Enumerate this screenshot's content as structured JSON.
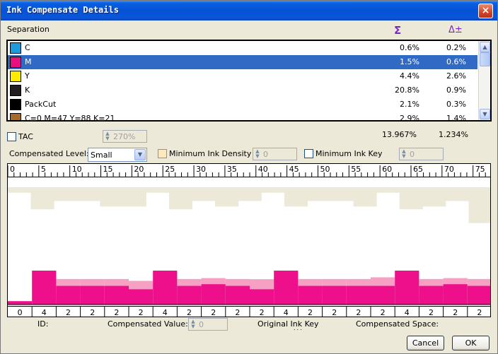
{
  "window": {
    "title": "Ink Compensate Details",
    "close_label": "×"
  },
  "separation": {
    "label": "Separation",
    "sum_icon": "Σ",
    "delta_icon": "Δ±",
    "rows": [
      {
        "name": "C",
        "v1": "0.6%",
        "v2": "0.2%",
        "color": "#1e9bdc",
        "selected": false
      },
      {
        "name": "M",
        "v1": "1.5%",
        "v2": "0.6%",
        "color": "#e8107e",
        "selected": true
      },
      {
        "name": "Y",
        "v1": "4.4%",
        "v2": "2.6%",
        "color": "#ffeb00",
        "selected": false
      },
      {
        "name": "K",
        "v1": "20.8%",
        "v2": "0.9%",
        "color": "#231f20",
        "selected": false
      },
      {
        "name": "PackCut",
        "v1": "2.1%",
        "v2": "0.3%",
        "color": "#000000",
        "selected": false
      },
      {
        "name": "C=0 M=47 Y=88 K=21",
        "v1": "2.9%",
        "v2": "1.4%",
        "color": "#a86a2a",
        "selected": false
      }
    ],
    "total_v1": "13.967%",
    "total_v2": "1.234%"
  },
  "tac": {
    "label": "TAC",
    "value": "270%"
  },
  "compensated_level": {
    "label": "Compensated Level:",
    "value": "Small"
  },
  "min_ink_density": {
    "label": "Minimum Ink Density",
    "value": "0"
  },
  "min_ink_key": {
    "label": "Minimum Ink Key",
    "value": "0"
  },
  "chart_data": {
    "type": "bar",
    "ruler_labels": [
      "0",
      "5",
      "10",
      "15",
      "20",
      "25",
      "30",
      "35",
      "40",
      "45",
      "50",
      "55",
      "60",
      "65",
      "70",
      "75"
    ],
    "keys": [
      "0",
      "4",
      "2",
      "2",
      "2",
      "2",
      "4",
      "2",
      "2",
      "2",
      "2",
      "4",
      "2",
      "2",
      "2",
      "2",
      "4",
      "2",
      "2",
      "2"
    ],
    "upper_profile": [
      0.1,
      0.4,
      0.25,
      0.25,
      0.35,
      0.35,
      0.1,
      0.4,
      0.25,
      0.35,
      0.25,
      0.1,
      0.35,
      0.25,
      0.25,
      0.35,
      0.1,
      0.4,
      0.35,
      0.25,
      0.65
    ],
    "lower_values": [
      0.1,
      1.0,
      0.55,
      0.55,
      0.55,
      0.45,
      1.0,
      0.55,
      0.6,
      0.55,
      0.45,
      1.0,
      0.55,
      0.55,
      0.55,
      0.55,
      1.0,
      0.55,
      0.6,
      0.55
    ],
    "lower_overlay": [
      0.0,
      0.0,
      0.45,
      0.45,
      0.45,
      0.45,
      0.0,
      0.45,
      0.45,
      0.45,
      0.5,
      0.0,
      0.45,
      0.45,
      0.45,
      0.5,
      0.0,
      0.45,
      0.45,
      0.45
    ],
    "colors": {
      "upper": "#ece9d8",
      "bar": "#ee0f8a",
      "overlay": "#f6a0c4"
    }
  },
  "footer": {
    "id_label": "ID:",
    "compensated_value_label": "Compensated Value:",
    "compensated_value": "0",
    "original_ink_key_label": "Original Ink Key",
    "original_ink_key_value": "...",
    "compensated_space_label": "Compensated Space:",
    "cancel_label": "Cancel",
    "ok_label": "OK"
  }
}
